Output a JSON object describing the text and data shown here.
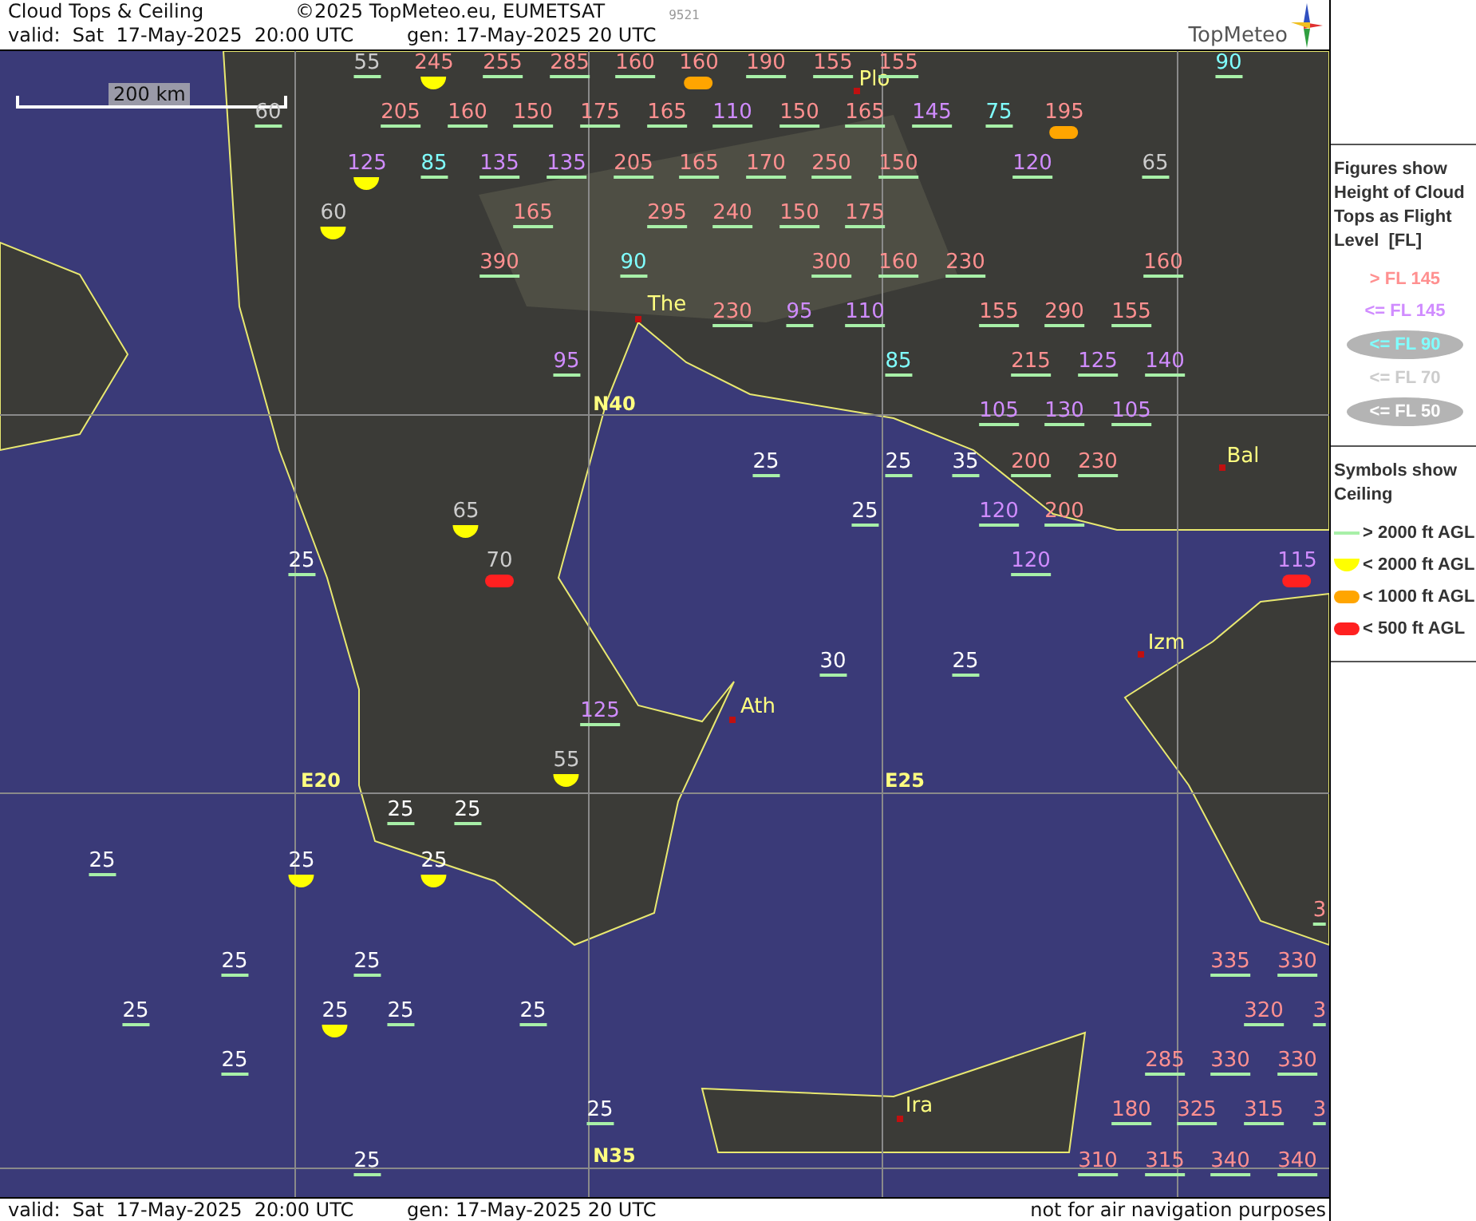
{
  "header": {
    "title": "Cloud Tops & Ceiling",
    "copyright": "©2025 TopMeteo.eu, EUMETSAT",
    "code": "9521",
    "valid": "valid:  Sat  17-May-2025  20:00 UTC",
    "generated": "gen: 17-May-2025 20 UTC",
    "logo": "TopMeteo"
  },
  "map": {
    "scale": "200 km",
    "grid_labels": [
      "N40",
      "E20",
      "E25",
      "N35"
    ],
    "cities": [
      "Plo",
      "The",
      "Bal",
      "Izm",
      "Ath",
      "Ira"
    ],
    "figures": [
      {
        "value": "55",
        "color": "#cccccc",
        "kind": "underline"
      },
      {
        "value": "245",
        "color": "#ff9090",
        "kind": "halfdisc"
      },
      {
        "value": "255",
        "color": "#ff9090",
        "kind": "underline"
      },
      {
        "value": "285",
        "color": "#ff9090",
        "kind": "underline"
      },
      {
        "value": "160",
        "color": "#ff9090",
        "kind": "underline"
      },
      {
        "value": "160",
        "color": "#ff9090",
        "kind": "amberpill"
      },
      {
        "value": "190",
        "color": "#ff9090",
        "kind": "underline"
      },
      {
        "value": "155",
        "color": "#ff9090",
        "kind": "underline"
      },
      {
        "value": "155",
        "color": "#ff9090",
        "kind": "underline"
      },
      {
        "value": "90",
        "color": "#80ffff",
        "kind": "underline"
      },
      {
        "value": "60",
        "color": "#cccccc",
        "kind": "underline"
      },
      {
        "value": "205",
        "color": "#ff9090",
        "kind": "underline"
      },
      {
        "value": "160",
        "color": "#ff9090",
        "kind": "underline"
      },
      {
        "value": "150",
        "color": "#ff9090",
        "kind": "underline"
      },
      {
        "value": "175",
        "color": "#ff9090",
        "kind": "underline"
      },
      {
        "value": "165",
        "color": "#ff9090",
        "kind": "underline"
      },
      {
        "value": "110",
        "color": "#d08cff",
        "kind": "underline"
      },
      {
        "value": "150",
        "color": "#ff9090",
        "kind": "underline"
      },
      {
        "value": "165",
        "color": "#ff9090",
        "kind": "underline"
      },
      {
        "value": "145",
        "color": "#d08cff",
        "kind": "underline"
      },
      {
        "value": "75",
        "color": "#80ffff",
        "kind": "underline"
      },
      {
        "value": "195",
        "color": "#ff9090",
        "kind": "amberpill"
      },
      {
        "value": "125",
        "color": "#d08cff",
        "kind": "halfdisc"
      },
      {
        "value": "85",
        "color": "#80ffff",
        "kind": "underline"
      },
      {
        "value": "135",
        "color": "#d08cff",
        "kind": "underline"
      },
      {
        "value": "135",
        "color": "#d08cff",
        "kind": "underline"
      },
      {
        "value": "205",
        "color": "#ff9090",
        "kind": "underline"
      },
      {
        "value": "165",
        "color": "#ff9090",
        "kind": "underline"
      },
      {
        "value": "170",
        "color": "#ff9090",
        "kind": "underline"
      },
      {
        "value": "250",
        "color": "#ff9090",
        "kind": "underline"
      },
      {
        "value": "150",
        "color": "#ff9090",
        "kind": "underline"
      },
      {
        "value": "120",
        "color": "#d08cff",
        "kind": "underline"
      },
      {
        "value": "65",
        "color": "#cccccc",
        "kind": "underline"
      },
      {
        "value": "60",
        "color": "#cccccc",
        "kind": "halfdisc"
      },
      {
        "value": "165",
        "color": "#ff9090",
        "kind": "underline"
      },
      {
        "value": "295",
        "color": "#ff9090",
        "kind": "underline"
      },
      {
        "value": "240",
        "color": "#ff9090",
        "kind": "underline"
      },
      {
        "value": "150",
        "color": "#ff9090",
        "kind": "underline"
      },
      {
        "value": "175",
        "color": "#ff9090",
        "kind": "underline"
      },
      {
        "value": "390",
        "color": "#ff9090",
        "kind": "underline"
      },
      {
        "value": "90",
        "color": "#80ffff",
        "kind": "underline"
      },
      {
        "value": "300",
        "color": "#ff9090",
        "kind": "underline"
      },
      {
        "value": "160",
        "color": "#ff9090",
        "kind": "underline"
      },
      {
        "value": "230",
        "color": "#ff9090",
        "kind": "underline"
      },
      {
        "value": "160",
        "color": "#ff9090",
        "kind": "underline"
      },
      {
        "value": "230",
        "color": "#ff9090",
        "kind": "underline"
      },
      {
        "value": "95",
        "color": "#d08cff",
        "kind": "underline"
      },
      {
        "value": "110",
        "color": "#d08cff",
        "kind": "underline"
      },
      {
        "value": "155",
        "color": "#ff9090",
        "kind": "underline"
      },
      {
        "value": "290",
        "color": "#ff9090",
        "kind": "underline"
      },
      {
        "value": "155",
        "color": "#ff9090",
        "kind": "underline"
      },
      {
        "value": "95",
        "color": "#d08cff",
        "kind": "underline"
      },
      {
        "value": "85",
        "color": "#80ffff",
        "kind": "underline"
      },
      {
        "value": "215",
        "color": "#ff9090",
        "kind": "underline"
      },
      {
        "value": "125",
        "color": "#d08cff",
        "kind": "underline"
      },
      {
        "value": "140",
        "color": "#d08cff",
        "kind": "underline"
      },
      {
        "value": "105",
        "color": "#d08cff",
        "kind": "underline"
      },
      {
        "value": "130",
        "color": "#d08cff",
        "kind": "underline"
      },
      {
        "value": "105",
        "color": "#d08cff",
        "kind": "underline"
      },
      {
        "value": "25",
        "color": "#ffffff",
        "kind": "underline"
      },
      {
        "value": "25",
        "color": "#ffffff",
        "kind": "underline"
      },
      {
        "value": "35",
        "color": "#ffffff",
        "kind": "underline"
      },
      {
        "value": "200",
        "color": "#ff9090",
        "kind": "underline"
      },
      {
        "value": "230",
        "color": "#ff9090",
        "kind": "underline"
      },
      {
        "value": "65",
        "color": "#cccccc",
        "kind": "halfdisc"
      },
      {
        "value": "25",
        "color": "#ffffff",
        "kind": "underline"
      },
      {
        "value": "120",
        "color": "#d08cff",
        "kind": "underline"
      },
      {
        "value": "200",
        "color": "#ff9090",
        "kind": "underline"
      },
      {
        "value": "25",
        "color": "#ffffff",
        "kind": "underline"
      },
      {
        "value": "70",
        "color": "#cccccc",
        "kind": "redpill"
      },
      {
        "value": "120",
        "color": "#d08cff",
        "kind": "underline"
      },
      {
        "value": "115",
        "color": "#d08cff",
        "kind": "redpill"
      },
      {
        "value": "30",
        "color": "#ffffff",
        "kind": "underline"
      },
      {
        "value": "25",
        "color": "#ffffff",
        "kind": "underline"
      },
      {
        "value": "125",
        "color": "#d08cff",
        "kind": "underline"
      },
      {
        "value": "55",
        "color": "#cccccc",
        "kind": "halfdisc"
      },
      {
        "value": "25",
        "color": "#ffffff",
        "kind": "underline"
      },
      {
        "value": "25",
        "color": "#ffffff",
        "kind": "underline"
      },
      {
        "value": "25",
        "color": "#ffffff",
        "kind": "underline"
      },
      {
        "value": "25",
        "color": "#ffffff",
        "kind": "halfdisc"
      },
      {
        "value": "25",
        "color": "#ffffff",
        "kind": "halfdisc"
      },
      {
        "value": "3",
        "color": "#ff9090",
        "kind": "underline"
      },
      {
        "value": "25",
        "color": "#ffffff",
        "kind": "underline"
      },
      {
        "value": "25",
        "color": "#ffffff",
        "kind": "underline"
      },
      {
        "value": "335",
        "color": "#ff9090",
        "kind": "underline"
      },
      {
        "value": "330",
        "color": "#ff9090",
        "kind": "underline"
      },
      {
        "value": "25",
        "color": "#ffffff",
        "kind": "underline"
      },
      {
        "value": "25",
        "color": "#ffffff",
        "kind": "halfdisc"
      },
      {
        "value": "25",
        "color": "#ffffff",
        "kind": "underline"
      },
      {
        "value": "25",
        "color": "#ffffff",
        "kind": "underline"
      },
      {
        "value": "320",
        "color": "#ff9090",
        "kind": "underline"
      },
      {
        "value": "3",
        "color": "#ff9090",
        "kind": "underline"
      },
      {
        "value": "25",
        "color": "#ffffff",
        "kind": "underline"
      },
      {
        "value": "285",
        "color": "#ff9090",
        "kind": "underline"
      },
      {
        "value": "330",
        "color": "#ff9090",
        "kind": "underline"
      },
      {
        "value": "330",
        "color": "#ff9090",
        "kind": "underline"
      },
      {
        "value": "25",
        "color": "#ffffff",
        "kind": "underline"
      },
      {
        "value": "180",
        "color": "#ff9090",
        "kind": "underline"
      },
      {
        "value": "325",
        "color": "#ff9090",
        "kind": "underline"
      },
      {
        "value": "315",
        "color": "#ff9090",
        "kind": "underline"
      },
      {
        "value": "3",
        "color": "#ff9090",
        "kind": "underline"
      },
      {
        "value": "25",
        "color": "#ffffff",
        "kind": "underline"
      },
      {
        "value": "310",
        "color": "#ff9090",
        "kind": "underline"
      },
      {
        "value": "315",
        "color": "#ff9090",
        "kind": "underline"
      },
      {
        "value": "340",
        "color": "#ff9090",
        "kind": "underline"
      },
      {
        "value": "340",
        "color": "#ff9090",
        "kind": "underline"
      }
    ]
  },
  "footer": {
    "valid": "valid:  Sat  17-May-2025  20:00 UTC",
    "generated": "gen: 17-May-2025 20 UTC",
    "note": "not for air navigation purposes"
  },
  "legend": {
    "figures_title": "Figures show Height of Cloud Tops as Flight Level  [FL]",
    "bands": [
      {
        "label": "> FL 145",
        "color": "#ff9090",
        "kind": "plain"
      },
      {
        "label": "<= FL 145",
        "color": "#d08cff",
        "kind": "plain"
      },
      {
        "label": "<= FL 90",
        "color": "#80ffff",
        "kind": "oval"
      },
      {
        "label": "<= FL 70",
        "color": "#cccccc",
        "kind": "plain"
      },
      {
        "label": "<= FL 50",
        "color": "#ffffff",
        "kind": "oval"
      }
    ],
    "symbols_title": "Symbols show Ceiling",
    "symbols": [
      {
        "label": "> 2000 ft AGL",
        "kind": "underline"
      },
      {
        "label": "< 2000 ft AGL",
        "kind": "halfdisc"
      },
      {
        "label": "< 1000 ft AGL",
        "kind": "amberpill"
      },
      {
        "label": "< 500 ft AGL",
        "kind": "redpill"
      }
    ]
  }
}
